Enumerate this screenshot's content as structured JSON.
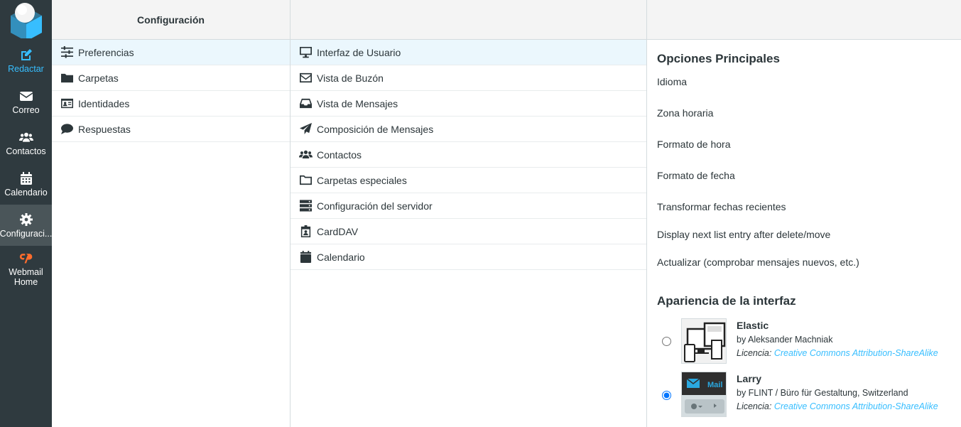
{
  "nav": {
    "items": [
      {
        "label": "Redactar",
        "icon": "compose-icon"
      },
      {
        "label": "Correo",
        "icon": "mail-icon"
      },
      {
        "label": "Contactos",
        "icon": "contacts-icon"
      },
      {
        "label": "Calendario",
        "icon": "calendar-icon"
      },
      {
        "label": "Configuraci...",
        "icon": "gear-icon"
      },
      {
        "label": "Webmail Home",
        "icon": "cpanel-icon"
      }
    ],
    "active_color": "#4a5559",
    "accent": "#37beff"
  },
  "settings": {
    "header": "Configuración",
    "items": [
      {
        "label": "Preferencias",
        "icon": "sliders-icon"
      },
      {
        "label": "Carpetas",
        "icon": "folder-icon"
      },
      {
        "label": "Identidades",
        "icon": "id-card-icon"
      },
      {
        "label": "Respuestas",
        "icon": "comment-icon"
      }
    ]
  },
  "sections": {
    "items": [
      {
        "label": "Interfaz de Usuario",
        "icon": "desktop-icon"
      },
      {
        "label": "Vista de Buzón",
        "icon": "envelope-icon"
      },
      {
        "label": "Vista de Mensajes",
        "icon": "inbox-icon"
      },
      {
        "label": "Composición de Mensajes",
        "icon": "paper-plane-icon"
      },
      {
        "label": "Contactos",
        "icon": "users-icon"
      },
      {
        "label": "Carpetas especiales",
        "icon": "folder-outline-icon"
      },
      {
        "label": "Configuración del servidor",
        "icon": "server-icon"
      },
      {
        "label": "CardDAV",
        "icon": "id-badge-icon"
      },
      {
        "label": "Calendario",
        "icon": "calendar-icon"
      }
    ]
  },
  "prefs": {
    "main_title": "Opciones Principales",
    "options": [
      "Idioma",
      "Zona horaria",
      "Formato de hora",
      "Formato de fecha",
      "Transformar fechas recientes",
      "Display next list entry after delete/move",
      "Actualizar (comprobar mensajes nuevos, etc.)"
    ],
    "appearance_title": "Apariencia de la interfaz",
    "skins": [
      {
        "name": "Elastic",
        "author": "by Aleksander Machniak",
        "license_label": "Licencia:",
        "license": "Creative Commons Attribution-ShareAlike",
        "selected": false
      },
      {
        "name": "Larry",
        "author": "by FLINT / Büro für Gestaltung, Switzerland",
        "license_label": "Licencia:",
        "license": "Creative Commons Attribution-ShareAlike",
        "selected": true,
        "thumb_text": "Mail"
      }
    ]
  }
}
